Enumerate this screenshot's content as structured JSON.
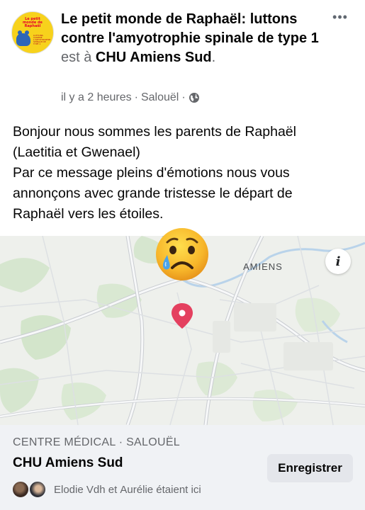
{
  "post": {
    "page_name": "Le petit monde de Raphaël: luttons contre l'amyotrophie spinale de type 1",
    "at_text": "est à",
    "place_name": "CHU Amiens Sud",
    "period": ".",
    "time": "il y a 2 heures",
    "location": "Salouël",
    "separator": "·",
    "more_label": "•••",
    "privacy_icon": "globe-icon"
  },
  "avatar": {
    "title": "Le petit monde de Raphaël",
    "subtitle": "LUTTONS CONTRE L'AMYOTROPHIE SPINALE DE TYPE 1"
  },
  "body": {
    "lines": [
      "Bonjour nous sommes les parents de Raphaël",
      "(Laetitia et Gwenael)",
      "Par ce message pleins d'émotions nous vous",
      "annonçons avec grande tristesse le départ de",
      "Raphaël vers les étoiles."
    ],
    "emoji": "crying-face"
  },
  "map": {
    "city_label": "AMIENS",
    "info_label": "i",
    "pin_color": "#e4405f"
  },
  "place_card": {
    "category": "CENTRE MÉDICAL · SALOUËL",
    "title": "CHU Amiens Sud",
    "save_label": "Enregistrer",
    "visitor_1": "Elodie Vdh",
    "and_text": "et",
    "visitor_2": "Aurélie",
    "visitors_suffix": "étaient ici"
  },
  "colors": {
    "secondary_text": "#65676b",
    "card_background": "#f0f2f5",
    "button_background": "#e4e6eb"
  }
}
